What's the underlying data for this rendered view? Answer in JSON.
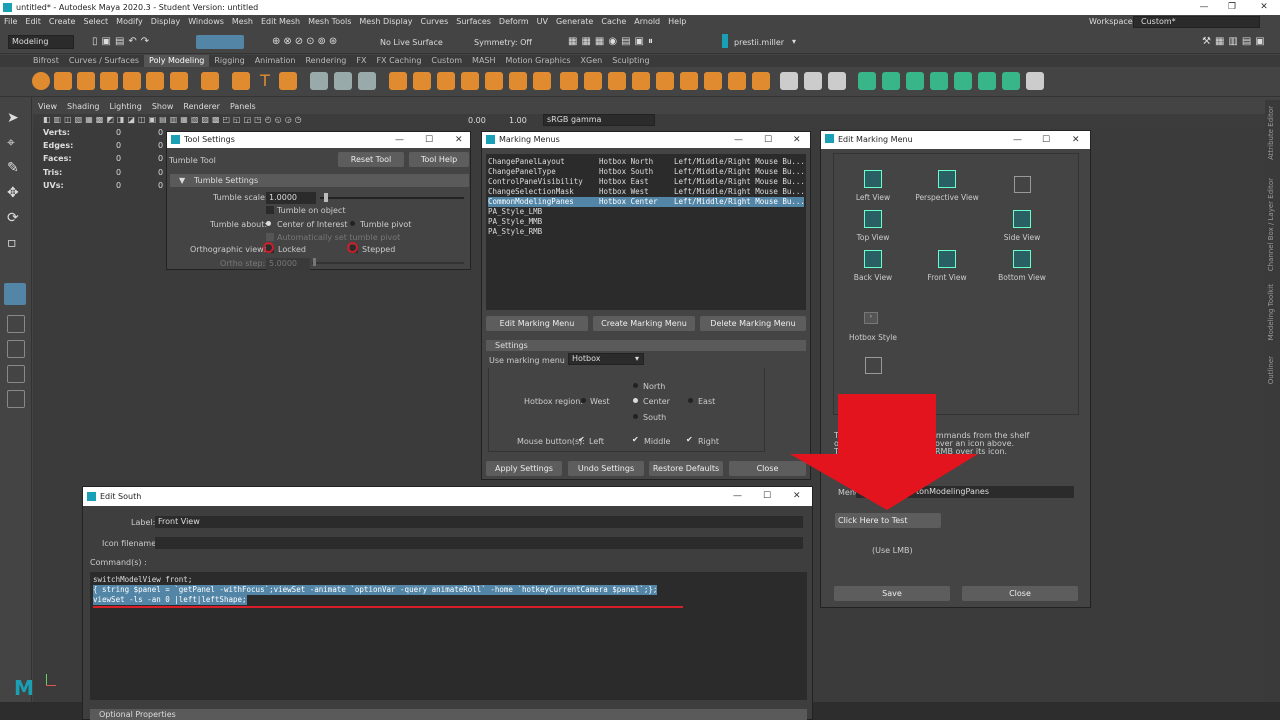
{
  "app": {
    "title": "untitled* - Autodesk Maya 2020.3 - Student Version: untitled"
  },
  "menubar": [
    "File",
    "Edit",
    "Create",
    "Select",
    "Modify",
    "Display",
    "Windows",
    "Mesh",
    "Edit Mesh",
    "Mesh Tools",
    "Mesh Display",
    "Curves",
    "Surfaces",
    "Deform",
    "UV",
    "Generate",
    "Cache",
    "Arnold",
    "Help"
  ],
  "workspace": {
    "label": "Workspace :",
    "value": "Custom*"
  },
  "statusline": {
    "mode": "Modeling",
    "live_surface": "No Live Surface",
    "symmetry": "Symmetry: Off",
    "user": "prestii.miller"
  },
  "shelf_tabs": [
    "Bifrost",
    "Curves / Surfaces",
    "Poly Modeling",
    "Rigging",
    "Animation",
    "Rendering",
    "FX",
    "FX Caching",
    "Custom",
    "MASH",
    "Motion Graphics",
    "XGen",
    "Sculpting"
  ],
  "shelf_active": "Poly Modeling",
  "panel_menu": [
    "View",
    "Shading",
    "Lighting",
    "Show",
    "Renderer",
    "Panels"
  ],
  "panel_toolbar": {
    "val1": "0.00",
    "val2": "1.00",
    "colorspace": "sRGB gamma"
  },
  "hud": [
    {
      "label": "Verts:",
      "v1": "0",
      "v2": "0"
    },
    {
      "label": "Edges:",
      "v1": "0",
      "v2": "0"
    },
    {
      "label": "Faces:",
      "v1": "0",
      "v2": "0"
    },
    {
      "label": "Tris:",
      "v1": "0",
      "v2": "0"
    },
    {
      "label": "UVs:",
      "v1": "0",
      "v2": "0"
    }
  ],
  "right_tabs": [
    "Attribute Editor",
    "Channel Box / Layer Editor",
    "Modeling Toolkit",
    "Outliner"
  ],
  "tool_settings": {
    "title": "Tool Settings",
    "tool_name": "Tumble Tool",
    "reset": "Reset Tool",
    "help": "Tool Help",
    "section": "Tumble Settings",
    "scale_label": "Tumble scale:",
    "scale_value": "1.0000",
    "on_object": "Tumble on object",
    "about_label": "Tumble about:",
    "about_coi": "Center of Interest",
    "about_pivot": "Tumble pivot",
    "auto_pivot": "Automatically set tumble pivot",
    "ortho_label": "Orthographic views:",
    "locked": "Locked",
    "stepped": "Stepped",
    "ortho_step_label": "Ortho step:",
    "ortho_step_value": "5.0000"
  },
  "marking_menus": {
    "title": "Marking Menus",
    "rows": [
      {
        "name": "ChangePanelLayout",
        "location": "Hotbox North",
        "button": "Left/Middle/Right Mouse Bu..."
      },
      {
        "name": "ChangePanelType",
        "location": "Hotbox South",
        "button": "Left/Middle/Right Mouse Bu..."
      },
      {
        "name": "ControlPaneVisibility",
        "location": "Hotbox East",
        "button": "Left/Middle/Right Mouse Bu..."
      },
      {
        "name": "ChangeSelectionMask",
        "location": "Hotbox West",
        "button": "Left/Middle/Right Mouse Bu..."
      },
      {
        "name": "CommonModelingPanes",
        "location": "Hotbox Center",
        "button": "Left/Middle/Right Mouse Bu..."
      },
      {
        "name": "PA_Style_LMB",
        "location": "",
        "button": ""
      },
      {
        "name": "PA_Style_MMB",
        "location": "",
        "button": ""
      },
      {
        "name": "PA_Style_RMB",
        "location": "",
        "button": ""
      }
    ],
    "edit_btn": "Edit Marking Menu",
    "create_btn": "Create Marking Menu",
    "delete_btn": "Delete Marking Menu",
    "settings": "Settings",
    "use_in_label": "Use marking menu in:",
    "use_in_value": "Hotbox",
    "region_label": "Hotbox region:",
    "north": "North",
    "west": "West",
    "center": "Center",
    "east": "East",
    "south": "South",
    "buttons_label": "Mouse button(s):",
    "left": "Left",
    "middle": "Middle",
    "right": "Right",
    "apply": "Apply Settings",
    "undo": "Undo Settings",
    "restore": "Restore Defaults",
    "close": "Close"
  },
  "edit_marking_menu": {
    "title": "Edit Marking Menu",
    "items": [
      "Left View",
      "Perspective View",
      "Top View",
      "Side View",
      "Back View",
      "Front View",
      "Bottom View",
      "Hotbox Style"
    ],
    "help_l1": "T",
    "help_r1": "ommands from the shelf",
    "help_l2": "o",
    "help_r2": "over an icon above.",
    "help_l3": "T",
    "help_r3": "RMB over its icon.",
    "menu_label": "Menu",
    "menu_value": "tonModelingPanes",
    "test_btn": "Click Here to Test",
    "use_lmb": "(Use LMB)",
    "save": "Save",
    "close": "Close"
  },
  "edit_south": {
    "title": "Edit South",
    "label_label": "Label:",
    "label_value": "Front View",
    "icon_label": "Icon filename:",
    "icon_value": "",
    "cmd_label": "Command(s) :",
    "cmd_lines": [
      "switchModelView front;",
      "{ string $panel = `getPanel -withFocus`;viewSet -animate `optionVar -query animateRoll` -home `hotkeyCurrentCamera $panel`;};",
      "viewSet -ls -an 0 |left|leftShape;"
    ],
    "optional": "Optional Properties"
  },
  "colors": {
    "accent": "#1aa0b4",
    "selection": "#5285a6",
    "annotation": "#d81e28"
  }
}
